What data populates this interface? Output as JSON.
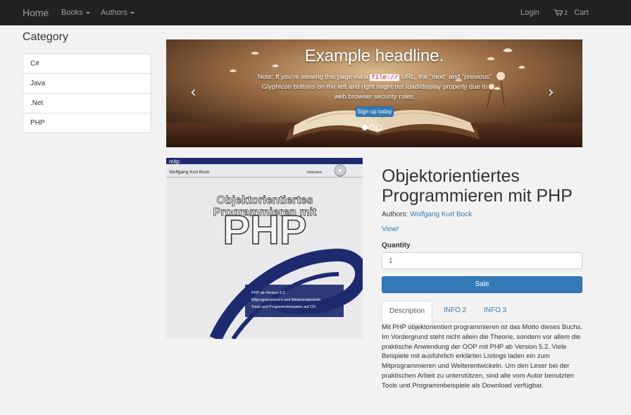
{
  "navbar": {
    "brand": "Home",
    "books": "Books",
    "authors": "Authors",
    "login": "Login",
    "cart_count": "2",
    "cart": "Cart"
  },
  "sidebar": {
    "title": "Category",
    "items": [
      {
        "label": "C#"
      },
      {
        "label": "Java"
      },
      {
        "label": ".Net"
      },
      {
        "label": "PHP"
      }
    ]
  },
  "carousel": {
    "headline": "Example headline.",
    "caption_pre": "Note: If you're viewing this page via a ",
    "caption_code": "file://",
    "caption_post": " URL, the \"next\" and \"previous\" Glyphicon buttons on the left and right might not load/display properly due to web browser security rules.",
    "button": "Sign up today",
    "prev_icon": "chevron-left-icon",
    "next_icon": "chevron-right-icon",
    "slide_count": 3,
    "active_slide": 1
  },
  "cover": {
    "publisher": "mitp",
    "author": "Wolfgang Kurt Bock",
    "badge": "inklusive",
    "cd": "CD",
    "title_line1": "Objektorientiertes",
    "title_line2": "Programmieren mit",
    "title_big": "PHP",
    "bullet1": "PHP ab Version 5.2",
    "bullet2": "Mitprogrammieren und Weiterentwickeln",
    "bullet3": "Tools und Programmbeispiele auf CD"
  },
  "product": {
    "title": "Objektorientiertes Programmieren mit PHP",
    "authors_label": "Authors: ",
    "author_name": "Wolfgang Kurt Bock",
    "view_link": "View!",
    "quantity_label": "Quantity",
    "quantity_value": "1",
    "sale_button": "Sale",
    "tabs": [
      {
        "label": "Description"
      },
      {
        "label": "INFO 2"
      },
      {
        "label": "INFO 3"
      }
    ],
    "description": "Mit PHP objektorientiert programmieren ist das Motto dieses Buchs. Im Vordergrund steht nicht allein die Theorie, sondern vor allem die praktische Anwendung der OOP mit PHP ab Version 5.2. Viele Beispiele mit ausführlich erklärten Listings laden ein zum Mitprogrammieren und Weiterentwickeln. Um den Leser bei der praktischen Arbeit zu unterstützen, sind alle vom Autor benutzten Tools und Programmbeispiele als Download verfügbar."
  },
  "colors": {
    "navbar_bg": "#222222",
    "link": "#337ab7",
    "primary_button": "#337ab7",
    "page_bg": "#f2f2f2",
    "cover_blue": "#1d2a6e"
  }
}
